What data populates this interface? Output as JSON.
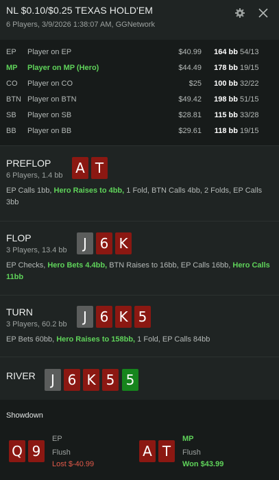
{
  "header": {
    "title": "NL $0.10/$0.25 TEXAS HOLD'EM",
    "subtitle": "6 Players, 3/9/2026 1:38:07 AM, GGNetwork"
  },
  "players": [
    {
      "pos": "EP",
      "name": "Player on EP",
      "stack": "$40.99",
      "bb": "164 bb",
      "stats": "54/13",
      "hero": false
    },
    {
      "pos": "MP",
      "name": "Player on MP (Hero)",
      "stack": "$44.49",
      "bb": "178 bb",
      "stats": "19/15",
      "hero": true
    },
    {
      "pos": "CO",
      "name": "Player on CO",
      "stack": "$25",
      "bb": "100 bb",
      "stats": "32/22",
      "hero": false
    },
    {
      "pos": "BTN",
      "name": "Player on BTN",
      "stack": "$49.42",
      "bb": "198 bb",
      "stats": "51/15",
      "hero": false
    },
    {
      "pos": "SB",
      "name": "Player on SB",
      "stack": "$28.81",
      "bb": "115 bb",
      "stats": "33/28",
      "hero": false
    },
    {
      "pos": "BB",
      "name": "Player on BB",
      "stack": "$29.61",
      "bb": "118 bb",
      "stats": "19/15",
      "hero": false
    }
  ],
  "preflop": {
    "name": "PREFLOP",
    "sub": "6 Players, 1.4 bb",
    "cards": [
      "A",
      "T"
    ],
    "actions": [
      "EP Calls 1bb, ",
      "Hero Raises to 4bb,",
      " 1 Fold, BTN Calls 4bb, 2 Folds, EP Calls 3bb"
    ]
  },
  "flop": {
    "name": "FLOP",
    "sub": "3 Players, 13.4 bb",
    "cards": [
      "J",
      "6",
      "K"
    ],
    "actions": [
      "EP Checks, ",
      "Hero Bets 4.4bb,",
      " BTN Raises to 16bb, EP Calls 16bb, ",
      "Hero Calls 11bb"
    ]
  },
  "turn": {
    "name": "TURN",
    "sub": "3 Players, 60.2 bb",
    "cards": [
      "J",
      "6",
      "K",
      "5"
    ],
    "actions": [
      "EP Bets 60bb, ",
      "Hero Raises to 158bb,",
      " 1 Fold, EP Calls 84bb"
    ]
  },
  "river": {
    "name": "RIVER",
    "cards": [
      "J",
      "6",
      "K",
      "5",
      "5"
    ]
  },
  "showdown": {
    "title": "Showdown",
    "players": [
      {
        "cards": [
          "Q",
          "9"
        ],
        "pos": "EP",
        "hand": "Flush",
        "result": "Lost $-40.99"
      },
      {
        "cards": [
          "A",
          "T"
        ],
        "pos": "MP",
        "hand": "Flush",
        "result": "Won $43.99"
      }
    ]
  },
  "colors": {
    "background": "#1f2423",
    "panel": "#171b1a",
    "hero_green": "#5fd35a",
    "card_red": "#8b1812",
    "card_gray": "#5b5d5c",
    "card_green": "#16851d",
    "loss_red": "#e35a4a"
  },
  "icons": {
    "settings": "gear-icon",
    "close": "close-icon"
  }
}
